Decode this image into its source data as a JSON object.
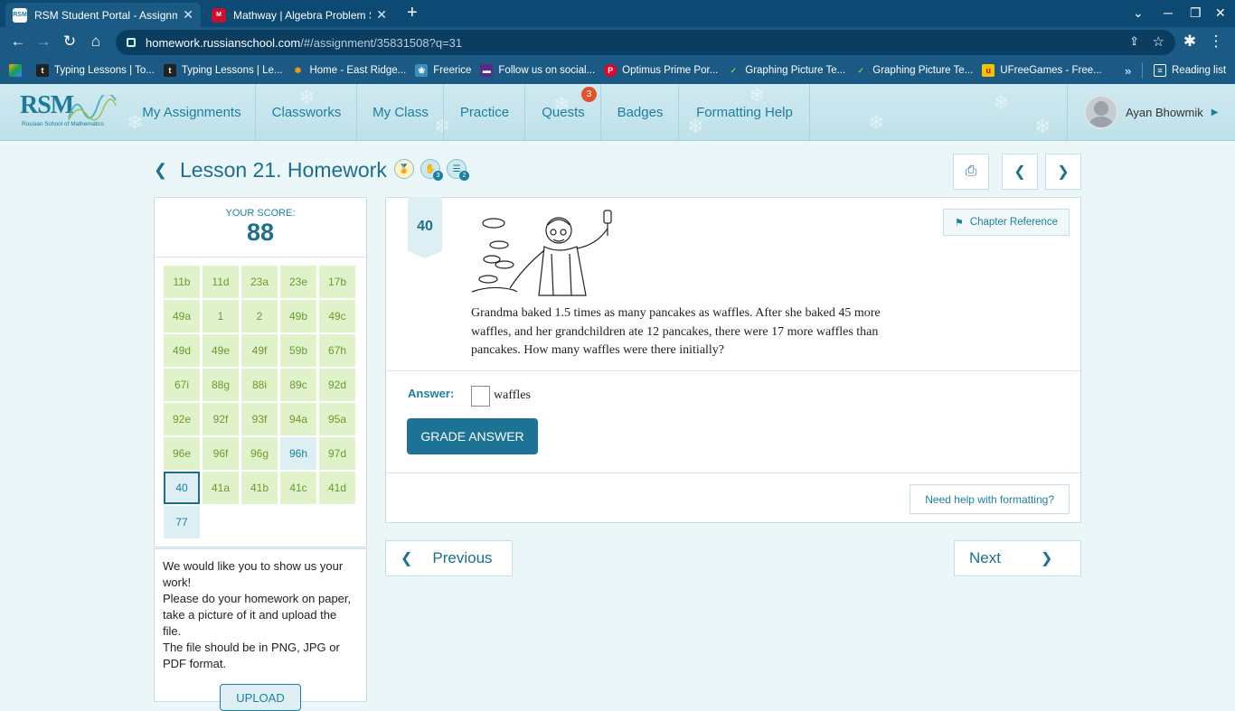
{
  "browser": {
    "tabs": [
      {
        "title": "RSM Student Portal - Assignment",
        "icon": "rsm-favicon",
        "active": true
      },
      {
        "title": "Mathway | Algebra Problem Solver",
        "icon": "mathway-favicon",
        "active": false
      }
    ],
    "url_host": "homework.russianschool.com",
    "url_path": "/#/assignment/35831508?q=31",
    "bookmarks": [
      {
        "label": "",
        "icon": "google-drive-icon"
      },
      {
        "label": "Typing Lessons | To...",
        "icon": "t-icon"
      },
      {
        "label": "Typing Lessons | Le...",
        "icon": "t-icon"
      },
      {
        "label": "Home - East Ridge...",
        "icon": "paw-icon"
      },
      {
        "label": "Freerice",
        "icon": "freerice-icon"
      },
      {
        "label": "Follow us on social...",
        "icon": "flag-icon"
      },
      {
        "label": "Optimus Prime Por...",
        "icon": "pinterest-icon"
      },
      {
        "label": "Graphing Picture Te...",
        "icon": "graph-icon"
      },
      {
        "label": "Graphing Picture Te...",
        "icon": "graph-icon"
      },
      {
        "label": "UFreeGames - Free...",
        "icon": "ufree-icon"
      }
    ],
    "reading_list": "Reading list"
  },
  "rsm_nav": {
    "logo_text": "RSM",
    "logo_sub": "Russian School of Mathematics",
    "items": [
      "My Assignments",
      "Classworks",
      "My Class",
      "Practice",
      "Quests",
      "Badges",
      "Formatting Help"
    ],
    "quests_badge": "3",
    "user_name": "Ayan Bhowmik"
  },
  "lesson": {
    "title": "Lesson 21. Homework",
    "badge_counts": [
      "3",
      "2"
    ]
  },
  "score": {
    "label": "YOUR SCORE:",
    "value": "88",
    "questions": [
      {
        "label": "11b",
        "state": "done"
      },
      {
        "label": "11d",
        "state": "done"
      },
      {
        "label": "23a",
        "state": "done"
      },
      {
        "label": "23e",
        "state": "done"
      },
      {
        "label": "17b",
        "state": "done"
      },
      {
        "label": "49a",
        "state": "done"
      },
      {
        "label": "1",
        "state": "done"
      },
      {
        "label": "2",
        "state": "done"
      },
      {
        "label": "49b",
        "state": "done"
      },
      {
        "label": "49c",
        "state": "done"
      },
      {
        "label": "49d",
        "state": "done"
      },
      {
        "label": "49e",
        "state": "done"
      },
      {
        "label": "49f",
        "state": "done"
      },
      {
        "label": "59b",
        "state": "done"
      },
      {
        "label": "67h",
        "state": "done"
      },
      {
        "label": "67i",
        "state": "done"
      },
      {
        "label": "88g",
        "state": "done"
      },
      {
        "label": "88i",
        "state": "done"
      },
      {
        "label": "89c",
        "state": "done"
      },
      {
        "label": "92d",
        "state": "done"
      },
      {
        "label": "92e",
        "state": "done"
      },
      {
        "label": "92f",
        "state": "done"
      },
      {
        "label": "93f",
        "state": "done"
      },
      {
        "label": "94a",
        "state": "done"
      },
      {
        "label": "95a",
        "state": "done"
      },
      {
        "label": "96e",
        "state": "done"
      },
      {
        "label": "96f",
        "state": "done"
      },
      {
        "label": "96g",
        "state": "done"
      },
      {
        "label": "96h",
        "state": "pending"
      },
      {
        "label": "97d",
        "state": "done"
      },
      {
        "label": "40",
        "state": "current"
      },
      {
        "label": "41a",
        "state": "done"
      },
      {
        "label": "41b",
        "state": "done"
      },
      {
        "label": "41c",
        "state": "done"
      },
      {
        "label": "41d",
        "state": "done"
      },
      {
        "label": "77",
        "state": "pending"
      }
    ]
  },
  "upload": {
    "line1": "We would like you to show us your work!",
    "line2": "Please do your homework on paper, take a picture of it and upload the file.",
    "line3": "The file should be in PNG, JPG or PDF format.",
    "button": "UPLOAD"
  },
  "problem": {
    "number": "40",
    "chapter_ref": "Chapter Reference",
    "text": "Grandma baked 1.5 times as many pancakes as waffles. After she baked 45 more waffles, and her grandchildren ate 12 pancakes, there were 17 more waffles than pancakes. How many waffles were there initially?",
    "answer_label": "Answer:",
    "answer_value": "",
    "answer_unit": "waffles",
    "grade_button": "GRADE ANSWER",
    "help_button": "Need help with formatting?"
  },
  "pager": {
    "previous": "Previous",
    "next": "Next"
  }
}
